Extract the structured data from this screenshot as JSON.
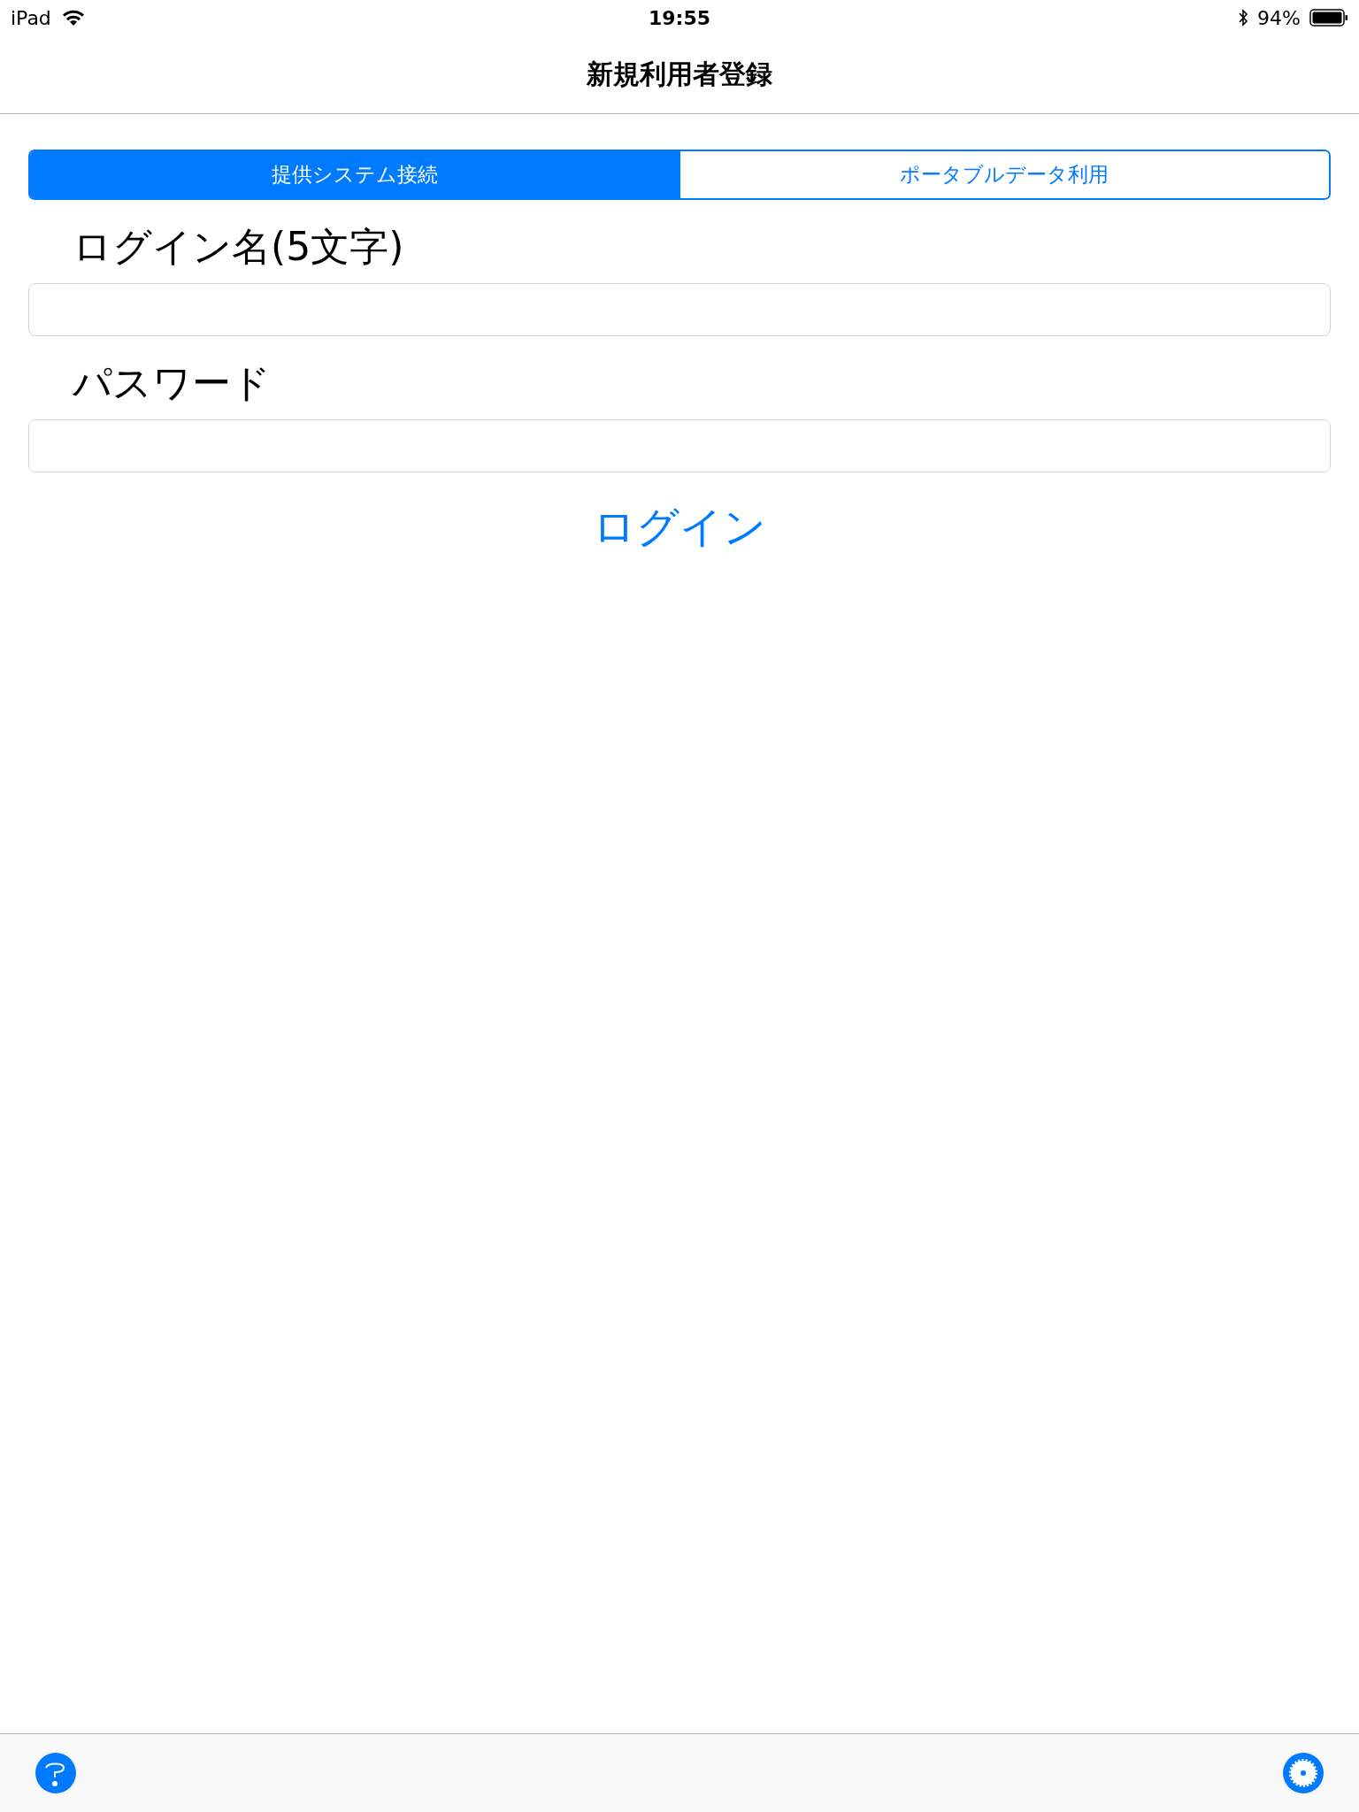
{
  "status_bar": {
    "device": "iPad",
    "time": "19:55",
    "battery": "94%"
  },
  "nav_bar": {
    "title": "新規利用者登録"
  },
  "tabs": [
    {
      "label": "提供システム接続",
      "selected": true
    },
    {
      "label": "ポータブルデータ利用",
      "selected": false
    }
  ],
  "fields": [
    {
      "label": "ログイン名(5文字)"
    },
    {
      "label": "パスワード"
    }
  ],
  "login_button": "ログイン"
}
